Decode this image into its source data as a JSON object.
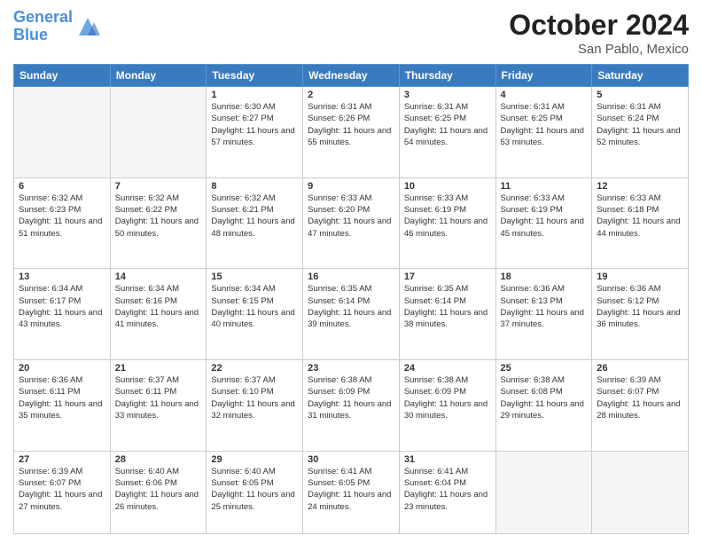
{
  "header": {
    "logo_line1": "General",
    "logo_line2": "Blue",
    "month": "October 2024",
    "location": "San Pablo, Mexico"
  },
  "weekdays": [
    "Sunday",
    "Monday",
    "Tuesday",
    "Wednesday",
    "Thursday",
    "Friday",
    "Saturday"
  ],
  "weeks": [
    [
      {
        "day": "",
        "info": ""
      },
      {
        "day": "",
        "info": ""
      },
      {
        "day": "1",
        "info": "Sunrise: 6:30 AM\nSunset: 6:27 PM\nDaylight: 11 hours and 57 minutes."
      },
      {
        "day": "2",
        "info": "Sunrise: 6:31 AM\nSunset: 6:26 PM\nDaylight: 11 hours and 55 minutes."
      },
      {
        "day": "3",
        "info": "Sunrise: 6:31 AM\nSunset: 6:25 PM\nDaylight: 11 hours and 54 minutes."
      },
      {
        "day": "4",
        "info": "Sunrise: 6:31 AM\nSunset: 6:25 PM\nDaylight: 11 hours and 53 minutes."
      },
      {
        "day": "5",
        "info": "Sunrise: 6:31 AM\nSunset: 6:24 PM\nDaylight: 11 hours and 52 minutes."
      }
    ],
    [
      {
        "day": "6",
        "info": "Sunrise: 6:32 AM\nSunset: 6:23 PM\nDaylight: 11 hours and 51 minutes."
      },
      {
        "day": "7",
        "info": "Sunrise: 6:32 AM\nSunset: 6:22 PM\nDaylight: 11 hours and 50 minutes."
      },
      {
        "day": "8",
        "info": "Sunrise: 6:32 AM\nSunset: 6:21 PM\nDaylight: 11 hours and 48 minutes."
      },
      {
        "day": "9",
        "info": "Sunrise: 6:33 AM\nSunset: 6:20 PM\nDaylight: 11 hours and 47 minutes."
      },
      {
        "day": "10",
        "info": "Sunrise: 6:33 AM\nSunset: 6:19 PM\nDaylight: 11 hours and 46 minutes."
      },
      {
        "day": "11",
        "info": "Sunrise: 6:33 AM\nSunset: 6:19 PM\nDaylight: 11 hours and 45 minutes."
      },
      {
        "day": "12",
        "info": "Sunrise: 6:33 AM\nSunset: 6:18 PM\nDaylight: 11 hours and 44 minutes."
      }
    ],
    [
      {
        "day": "13",
        "info": "Sunrise: 6:34 AM\nSunset: 6:17 PM\nDaylight: 11 hours and 43 minutes."
      },
      {
        "day": "14",
        "info": "Sunrise: 6:34 AM\nSunset: 6:16 PM\nDaylight: 11 hours and 41 minutes."
      },
      {
        "day": "15",
        "info": "Sunrise: 6:34 AM\nSunset: 6:15 PM\nDaylight: 11 hours and 40 minutes."
      },
      {
        "day": "16",
        "info": "Sunrise: 6:35 AM\nSunset: 6:14 PM\nDaylight: 11 hours and 39 minutes."
      },
      {
        "day": "17",
        "info": "Sunrise: 6:35 AM\nSunset: 6:14 PM\nDaylight: 11 hours and 38 minutes."
      },
      {
        "day": "18",
        "info": "Sunrise: 6:36 AM\nSunset: 6:13 PM\nDaylight: 11 hours and 37 minutes."
      },
      {
        "day": "19",
        "info": "Sunrise: 6:36 AM\nSunset: 6:12 PM\nDaylight: 11 hours and 36 minutes."
      }
    ],
    [
      {
        "day": "20",
        "info": "Sunrise: 6:36 AM\nSunset: 6:11 PM\nDaylight: 11 hours and 35 minutes."
      },
      {
        "day": "21",
        "info": "Sunrise: 6:37 AM\nSunset: 6:11 PM\nDaylight: 11 hours and 33 minutes."
      },
      {
        "day": "22",
        "info": "Sunrise: 6:37 AM\nSunset: 6:10 PM\nDaylight: 11 hours and 32 minutes."
      },
      {
        "day": "23",
        "info": "Sunrise: 6:38 AM\nSunset: 6:09 PM\nDaylight: 11 hours and 31 minutes."
      },
      {
        "day": "24",
        "info": "Sunrise: 6:38 AM\nSunset: 6:09 PM\nDaylight: 11 hours and 30 minutes."
      },
      {
        "day": "25",
        "info": "Sunrise: 6:38 AM\nSunset: 6:08 PM\nDaylight: 11 hours and 29 minutes."
      },
      {
        "day": "26",
        "info": "Sunrise: 6:39 AM\nSunset: 6:07 PM\nDaylight: 11 hours and 28 minutes."
      }
    ],
    [
      {
        "day": "27",
        "info": "Sunrise: 6:39 AM\nSunset: 6:07 PM\nDaylight: 11 hours and 27 minutes."
      },
      {
        "day": "28",
        "info": "Sunrise: 6:40 AM\nSunset: 6:06 PM\nDaylight: 11 hours and 26 minutes."
      },
      {
        "day": "29",
        "info": "Sunrise: 6:40 AM\nSunset: 6:05 PM\nDaylight: 11 hours and 25 minutes."
      },
      {
        "day": "30",
        "info": "Sunrise: 6:41 AM\nSunset: 6:05 PM\nDaylight: 11 hours and 24 minutes."
      },
      {
        "day": "31",
        "info": "Sunrise: 6:41 AM\nSunset: 6:04 PM\nDaylight: 11 hours and 23 minutes."
      },
      {
        "day": "",
        "info": ""
      },
      {
        "day": "",
        "info": ""
      }
    ]
  ]
}
